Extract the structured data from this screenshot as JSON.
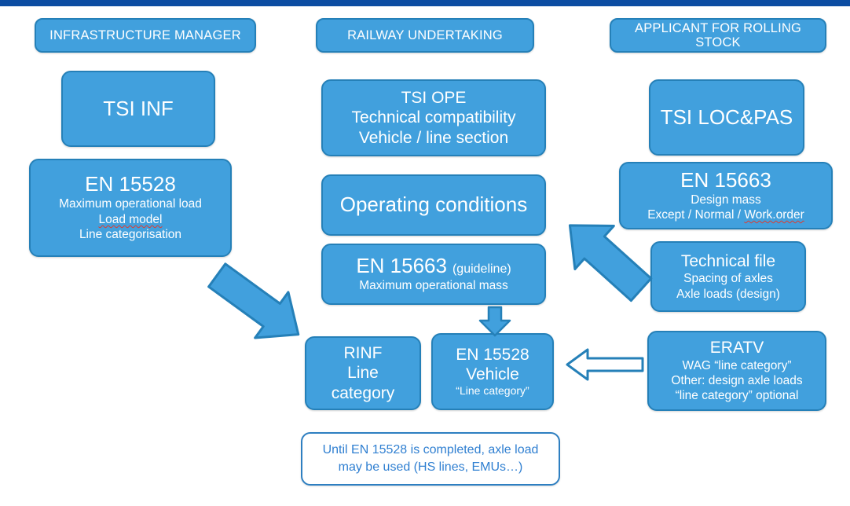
{
  "page": {
    "title": "Railway interoperability — line category / axle load responsibilities",
    "accent_dark": "#0c4da2",
    "box_fill": "#41a0dd",
    "box_border": "#2580b8",
    "note_text_color": "#2f7fd1",
    "spellcheck_color": "#e03b2f"
  },
  "columns": {
    "infrastructure_manager": {
      "header": "INFRASTRUCTURE MANAGER",
      "boxes": {
        "tsi_inf": {
          "title": "TSI INF"
        },
        "en15528": {
          "title": "EN 15528",
          "line1": "Maximum operational load",
          "line2": "Load model",
          "line3": "Line categorisation"
        }
      }
    },
    "railway_undertaking": {
      "header": "RAILWAY UNDERTAKING",
      "boxes": {
        "tsi_ope": {
          "title": "TSI OPE",
          "line1": "Technical  compatibility",
          "line2": "Vehicle / line section"
        },
        "operating_conditions": {
          "title": "Operating conditions"
        },
        "en15663": {
          "title": "EN 15663",
          "title_suffix": "(guideline)",
          "line1": "Maximum operational mass"
        },
        "rinf": {
          "line1": "RINF",
          "line2": "Line",
          "line3": "category"
        },
        "en15528_vehicle": {
          "line1": "EN 15528",
          "line2": "Vehicle",
          "line3": "“Line category”"
        }
      }
    },
    "applicant_rolling_stock": {
      "header": "APPLICANT FOR ROLLING STOCK",
      "boxes": {
        "tsi_loc_pas": {
          "title": "TSI LOC&PAS"
        },
        "en15663": {
          "title": "EN 15663",
          "line1": "Design mass",
          "line2_a": "Except / Normal / ",
          "line2_b": "Work.order"
        },
        "technical_file": {
          "title": "Technical file",
          "line1": "Spacing of axles",
          "line2": "Axle loads (design)"
        },
        "eratv": {
          "title": "ERATV",
          "line1": "WAG “line category”",
          "line2": "Other: design axle loads",
          "line3": "“line category” optional"
        }
      }
    }
  },
  "note": {
    "line1": "Until EN 15528 is completed, axle load",
    "line2": "may be used (HS lines, EMUs…)"
  },
  "arrows": [
    {
      "name": "arrow-im-to-rinf",
      "direction": "down-right",
      "style": "filled"
    },
    {
      "name": "arrow-applicant-to-ru",
      "direction": "up-left",
      "style": "filled"
    },
    {
      "name": "arrow-en15663-to-en15528-vehicle",
      "direction": "down",
      "style": "filled"
    },
    {
      "name": "arrow-eratv-to-en15528-vehicle",
      "direction": "left",
      "style": "outlined"
    }
  ]
}
